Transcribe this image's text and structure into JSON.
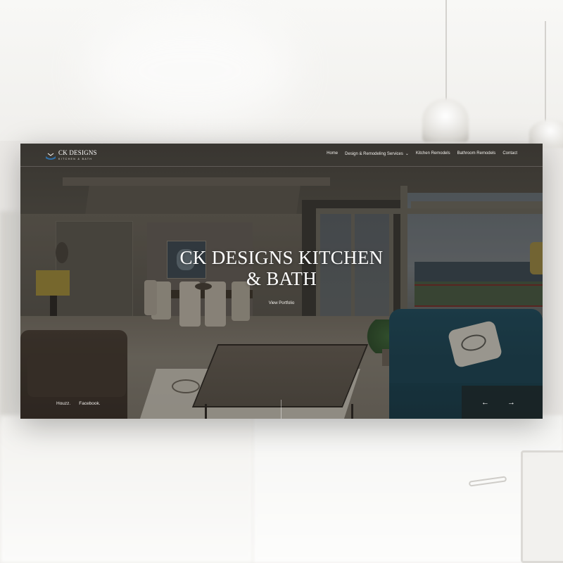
{
  "header": {
    "logo": {
      "name": "CK DESIGNS",
      "tagline": "KITCHEN & BATH"
    },
    "nav": [
      {
        "label": "Home"
      },
      {
        "label": "Design & Remodeling Services",
        "icon": "chevron-down-icon"
      },
      {
        "label": "Kitchen Remodels"
      },
      {
        "label": "Bathroom Remodels"
      },
      {
        "label": "Contact"
      }
    ]
  },
  "hero": {
    "title_line1": "CK DESIGNS KITCHEN",
    "title_line2": "& BATH",
    "cta_label": "View Portfolio"
  },
  "footer": {
    "social": [
      "Houzz.",
      "Facebook."
    ],
    "prev_icon": "arrow-left-icon",
    "next_icon": "arrow-right-icon"
  },
  "colors": {
    "overlay": "#2a2723",
    "accent_chair": "#1e4a5c",
    "logo_blue": "#2f6fa8"
  }
}
